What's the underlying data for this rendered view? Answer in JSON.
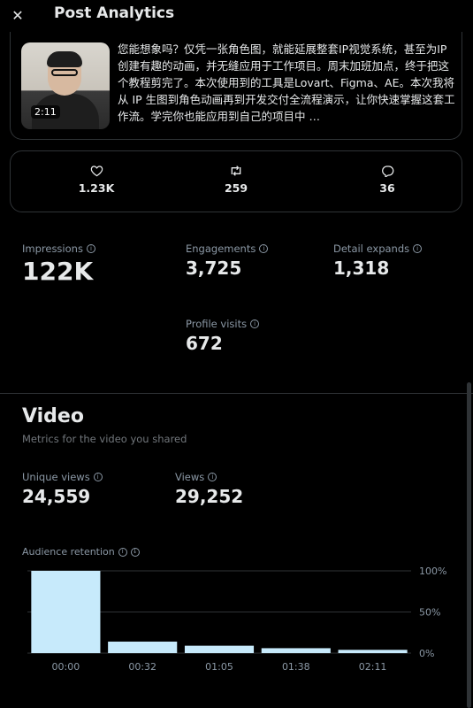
{
  "header": {
    "close_glyph": "✕",
    "title": "Post Analytics"
  },
  "post": {
    "duration": "2:11",
    "text": "您能想象吗？仅凭一张角色图，就能延展整套IP视觉系统，甚至为IP创建有趣的动画，并无缝应用于工作项目。周末加班加点，终于把这个教程剪完了。本次使用到的工具是Lovart、Figma、AE。本次我将从 IP 生图到角色动画再到开发交付全流程演示，让你快速掌握这套工作流。学完你也能应用到自己的项目中 …"
  },
  "engagement": {
    "likes": {
      "icon": "heart-icon",
      "value": "1.23K"
    },
    "reposts": {
      "icon": "repost-icon",
      "value": "259"
    },
    "replies": {
      "icon": "reply-icon",
      "value": "36"
    }
  },
  "metrics": {
    "impressions": {
      "label": "Impressions",
      "value": "122K"
    },
    "engagements": {
      "label": "Engagements",
      "value": "3,725"
    },
    "detail_expands": {
      "label": "Detail expands",
      "value": "1,318"
    },
    "profile_visits": {
      "label": "Profile visits",
      "value": "672"
    }
  },
  "video": {
    "title": "Video",
    "subtitle": "Metrics for the video you shared",
    "unique_views": {
      "label": "Unique views",
      "value": "24,559"
    },
    "views": {
      "label": "Views",
      "value": "29,252"
    },
    "retention_label": "Audience retention"
  },
  "colors": {
    "bar": "#c7eafb",
    "text": "#e7e9ea",
    "muted": "#8b98a5",
    "border": "#2f3336"
  },
  "chart_data": {
    "type": "bar",
    "categories": [
      "00:00",
      "00:32",
      "01:05",
      "01:38",
      "02:11"
    ],
    "values": [
      100,
      14,
      9,
      6,
      4
    ],
    "y_ticks": [
      "100%",
      "50%",
      "0%"
    ],
    "ylim": [
      0,
      100
    ],
    "grid": true
  }
}
